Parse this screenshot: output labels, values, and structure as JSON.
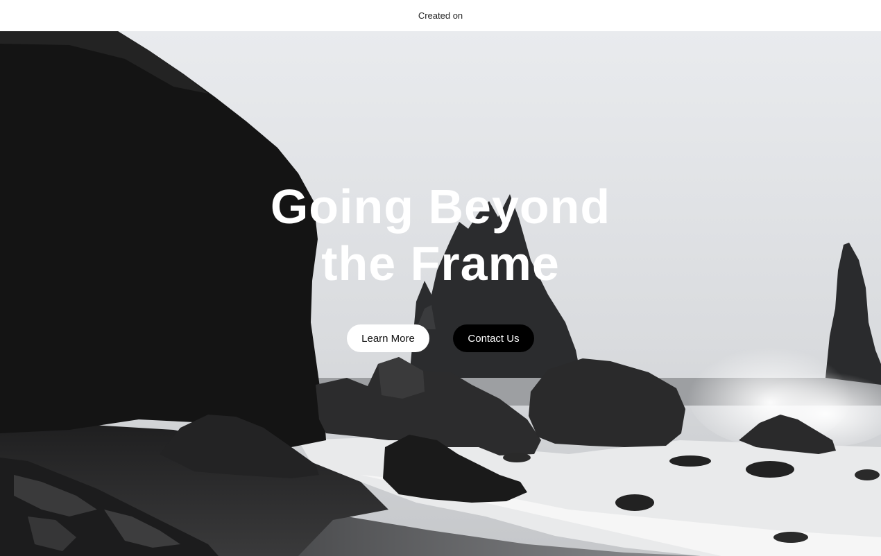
{
  "top_bar": {
    "text": "Created on"
  },
  "hero": {
    "headline_line1": "Going Beyond",
    "headline_line2": "the Frame",
    "learn_more_label": "Learn More",
    "contact_label": "Contact Us",
    "background": "black sand beach with rock cliffs, sea stacks and crashing waves under an overcast sky"
  },
  "colors": {
    "sky": "#e6e8ec",
    "rock": "#1a1a1a",
    "sand": "#2a2a2b",
    "foam": "#f2f2f2",
    "button_light": "#ffffff",
    "button_dark": "#000000"
  }
}
